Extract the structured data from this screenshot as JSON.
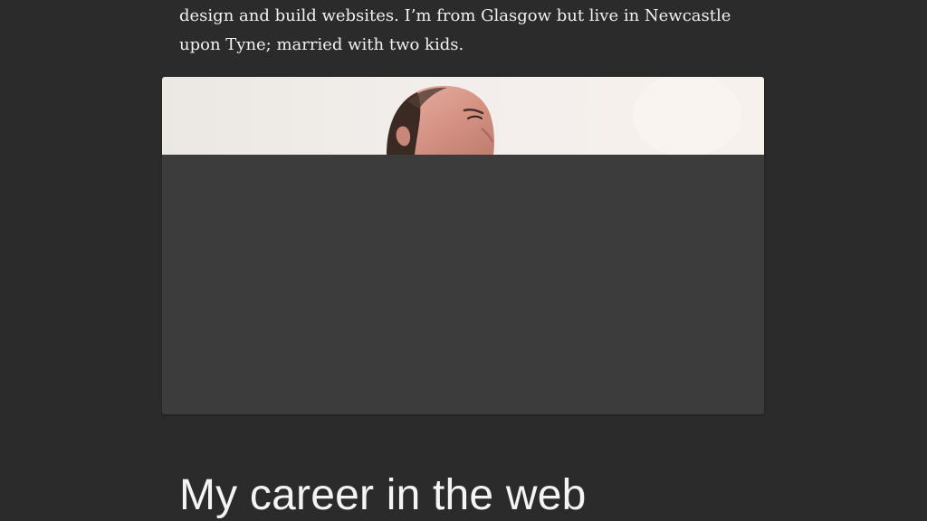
{
  "intro": {
    "lines": [
      "design and build websites. I’m from Glasgow but live in Newcastle",
      "upon Tyne; married with two kids."
    ]
  },
  "photo": {
    "subject": "portrait-photo"
  },
  "sections": {
    "career_heading": "My career in the web"
  },
  "colors": {
    "background": "#2b2b2b",
    "card_placeholder": "#3c3c3c",
    "text": "#f1f1f1"
  }
}
